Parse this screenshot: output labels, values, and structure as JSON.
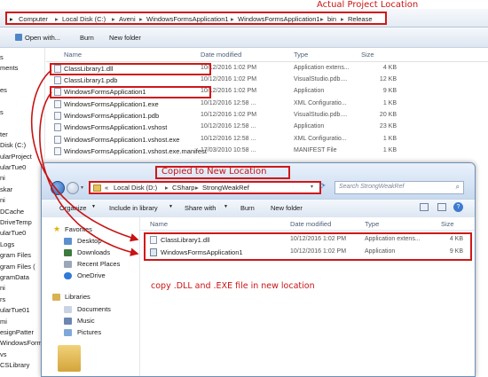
{
  "window1": {
    "breadcrumb": [
      "Computer",
      "Local Disk (C:)",
      "Aveni",
      "WindowsFormsApplication1",
      "WindowsFormsApplication1",
      "bin",
      "Release"
    ],
    "annotation": "Actual Project Location",
    "toolbar": {
      "open_with": "Open with...",
      "burn": "Burn",
      "new_folder": "New folder"
    },
    "columns": {
      "name": "Name",
      "date": "Date modified",
      "type": "Type",
      "size": "Size"
    },
    "files": [
      {
        "name": "ClassLibrary1.dll",
        "date": "10/12/2016 1:02 PM",
        "type": "Application extens...",
        "size": "4 KB"
      },
      {
        "name": "ClassLibrary1.pdb",
        "date": "10/12/2016 1:02 PM",
        "type": "VisualStudio.pdb....",
        "size": "12 KB"
      },
      {
        "name": "WindowsFormsApplication1",
        "date": "10/12/2016 1:02 PM",
        "type": "Application",
        "size": "9 KB"
      },
      {
        "name": "WindowsFormsApplication1.exe",
        "date": "10/12/2016 12:58 ...",
        "type": "XML Configuratio...",
        "size": "1 KB"
      },
      {
        "name": "WindowsFormsApplication1.pdb",
        "date": "10/12/2016 1:02 PM",
        "type": "VisualStudio.pdb....",
        "size": "20 KB"
      },
      {
        "name": "WindowsFormsApplication1.vshost",
        "date": "10/12/2016 12:58 ...",
        "type": "Application",
        "size": "23 KB"
      },
      {
        "name": "WindowsFormsApplication1.vshost.exe",
        "date": "10/12/2016 12:58 ...",
        "type": "XML Configuratio...",
        "size": "1 KB"
      },
      {
        "name": "WindowsFormsApplication1.vshost.exe.manifest",
        "date": "17/03/2010 10:58 ...",
        "type": "MANIFEST File",
        "size": "1 KB"
      }
    ],
    "sidebar": [
      "s",
      "ments",
      "",
      "es",
      "",
      "s",
      "",
      "ter",
      "Disk (C:)",
      "ularProject",
      "ularTue0",
      "ni",
      "skar",
      "ni",
      "DCache",
      "DriveTemp",
      "ularTue0",
      "Logs",
      "gram Files",
      "gram Files (",
      "gramData",
      "ni",
      "rs",
      "ularTue01",
      "mi",
      "esignPatter",
      "WindowsForm",
      "vs",
      "CSLibrary"
    ]
  },
  "window2": {
    "annotation": "Copied to New Location",
    "breadcrumb": [
      "Local Disk (D:)",
      "CSharp",
      "StrongWeakRef"
    ],
    "search_placeholder": "Search StrongWeakRef",
    "toolbar": {
      "organize": "Organize",
      "include": "Include in library",
      "share": "Share with",
      "burn": "Burn",
      "new_folder": "New folder"
    },
    "columns": {
      "name": "Name",
      "date": "Date modified",
      "type": "Type",
      "size": "Size"
    },
    "files": [
      {
        "name": "ClassLibrary1.dll",
        "date": "10/12/2016 1:02 PM",
        "type": "Application extens...",
        "size": "4 KB"
      },
      {
        "name": "WindowsFormsApplication1",
        "date": "10/12/2016 1:02 PM",
        "type": "Application",
        "size": "9 KB"
      }
    ],
    "sidebar": {
      "favorites": "Favorites",
      "desktop": "Desktop",
      "downloads": "Downloads",
      "recent": "Recent Places",
      "onedrive": "OneDrive",
      "libraries": "Libraries",
      "documents": "Documents",
      "music": "Music",
      "pictures": "Pictures"
    },
    "note": "copy .DLL and .EXE file in new location"
  },
  "colors": {
    "annotation": "#c81414",
    "accent": "#2e66b8"
  }
}
